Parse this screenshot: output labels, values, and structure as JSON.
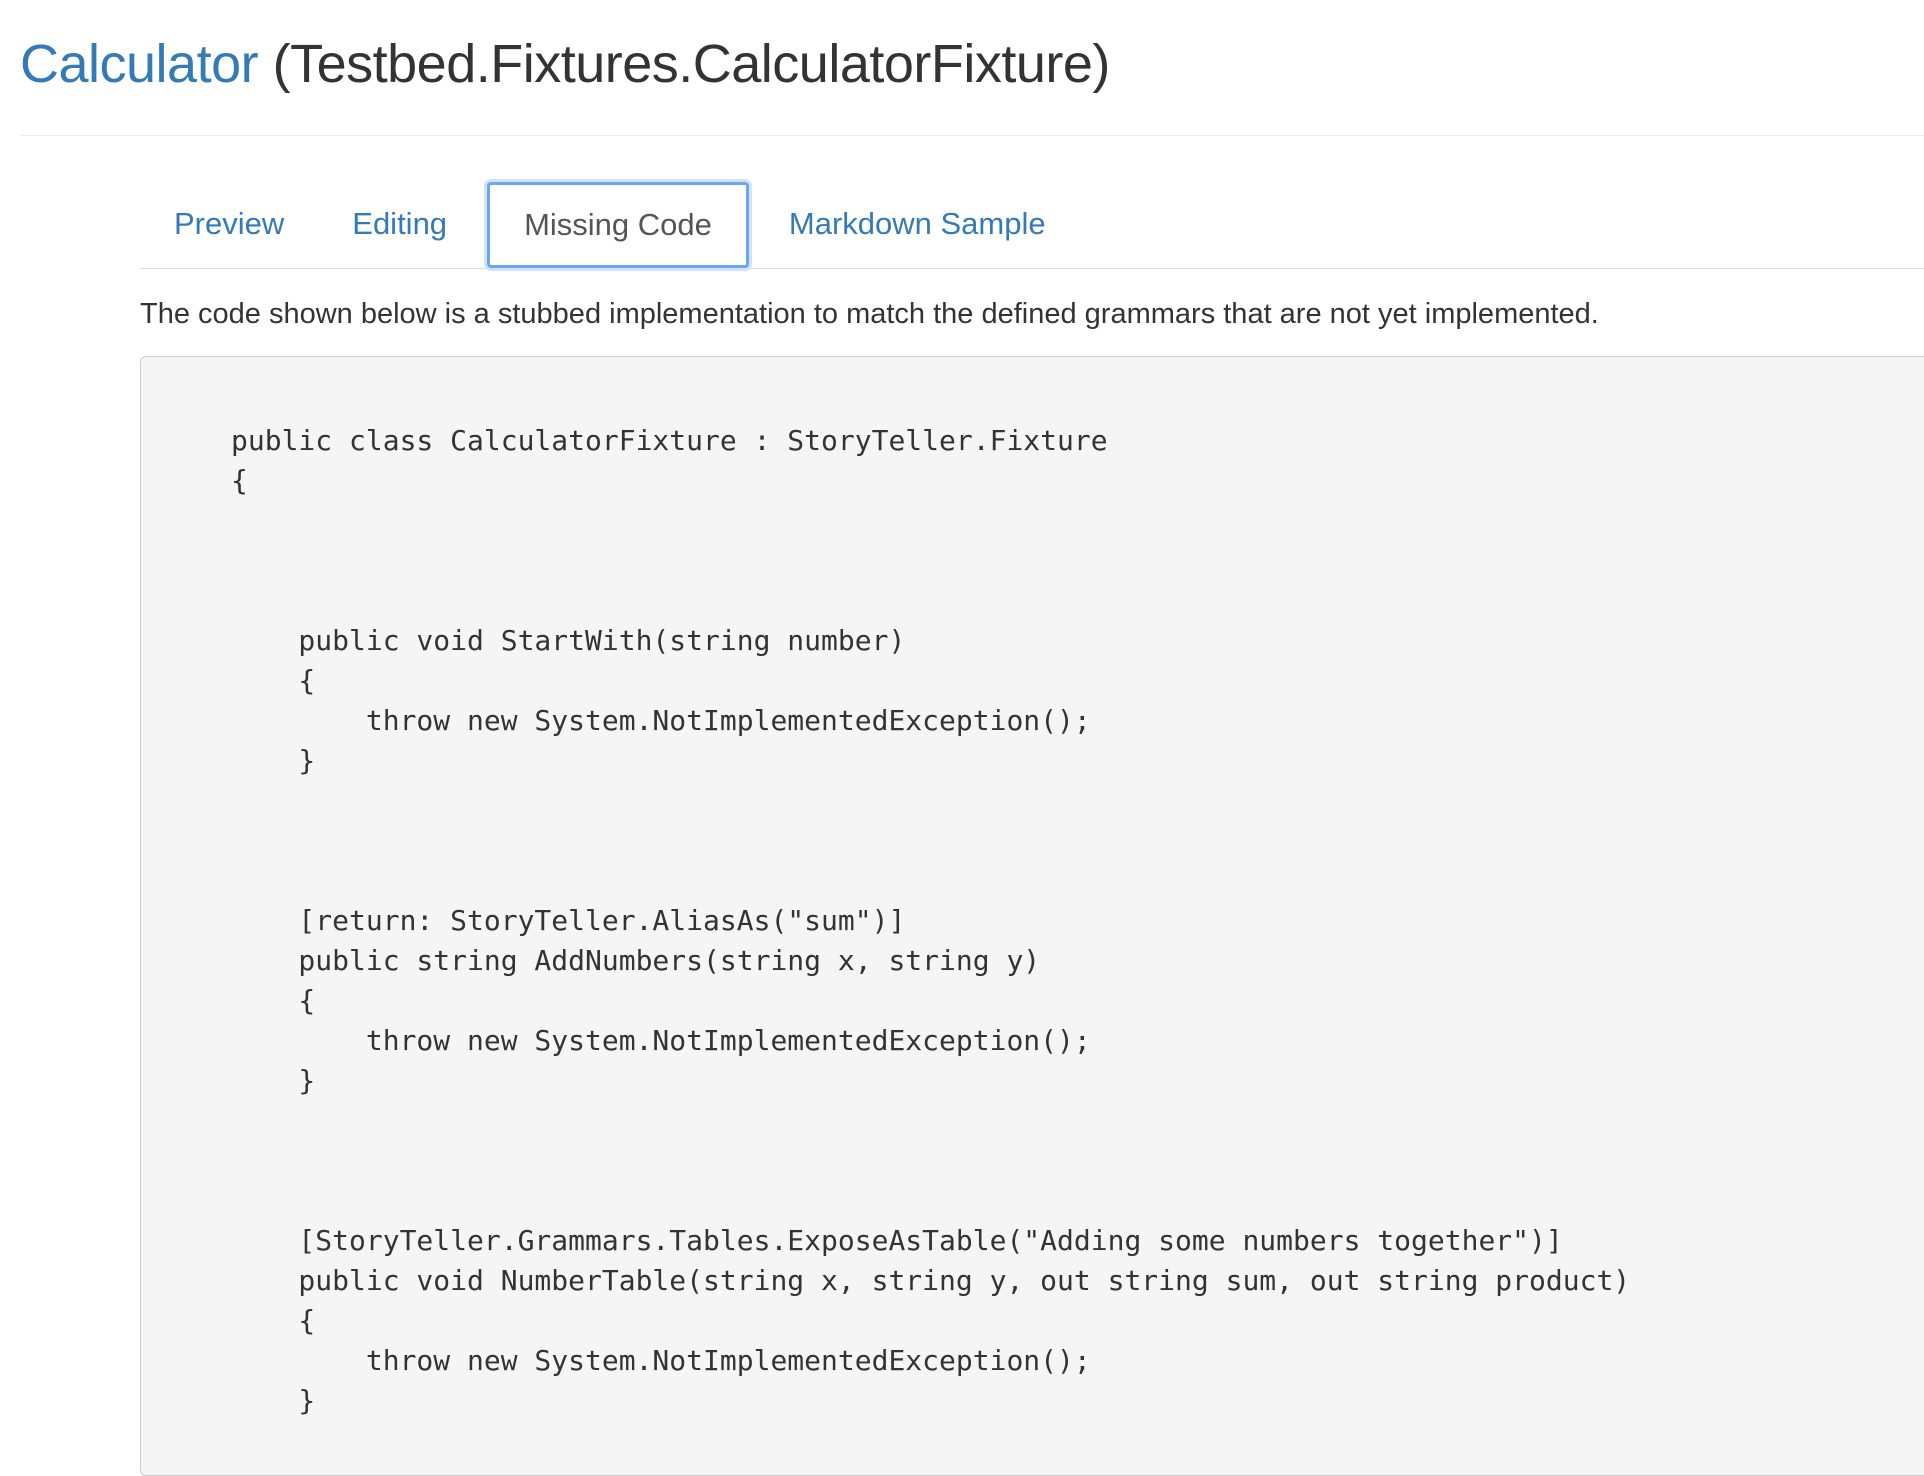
{
  "header": {
    "title_link": "Calculator",
    "title_fixture": "(Testbed.Fixtures.CalculatorFixture)"
  },
  "tabs": [
    {
      "label": "Preview",
      "active": false
    },
    {
      "label": "Editing",
      "active": false
    },
    {
      "label": "Missing Code",
      "active": true
    },
    {
      "label": "Markdown Sample",
      "active": false
    }
  ],
  "main": {
    "description": "The code shown below is a stubbed implementation to match the defined grammars that are not yet implemented.",
    "code": "public class CalculatorFixture : StoryTeller.Fixture\n{\n\n\n\n    public void StartWith(string number)\n    {\n        throw new System.NotImplementedException();\n    }\n\n\n\n    [return: StoryTeller.AliasAs(\"sum\")]\n    public string AddNumbers(string x, string y)\n    {\n        throw new System.NotImplementedException();\n    }\n\n\n\n    [StoryTeller.Grammars.Tables.ExposeAsTable(\"Adding some numbers together\")]\n    public void NumberTable(string x, string y, out string sum, out string product)\n    {\n        throw new System.NotImplementedException();\n    }"
  },
  "colors": {
    "link": "#337ab7",
    "text": "#333333",
    "code_background": "#f5f5f5",
    "active_tab_focus": "#6aa7ee"
  }
}
